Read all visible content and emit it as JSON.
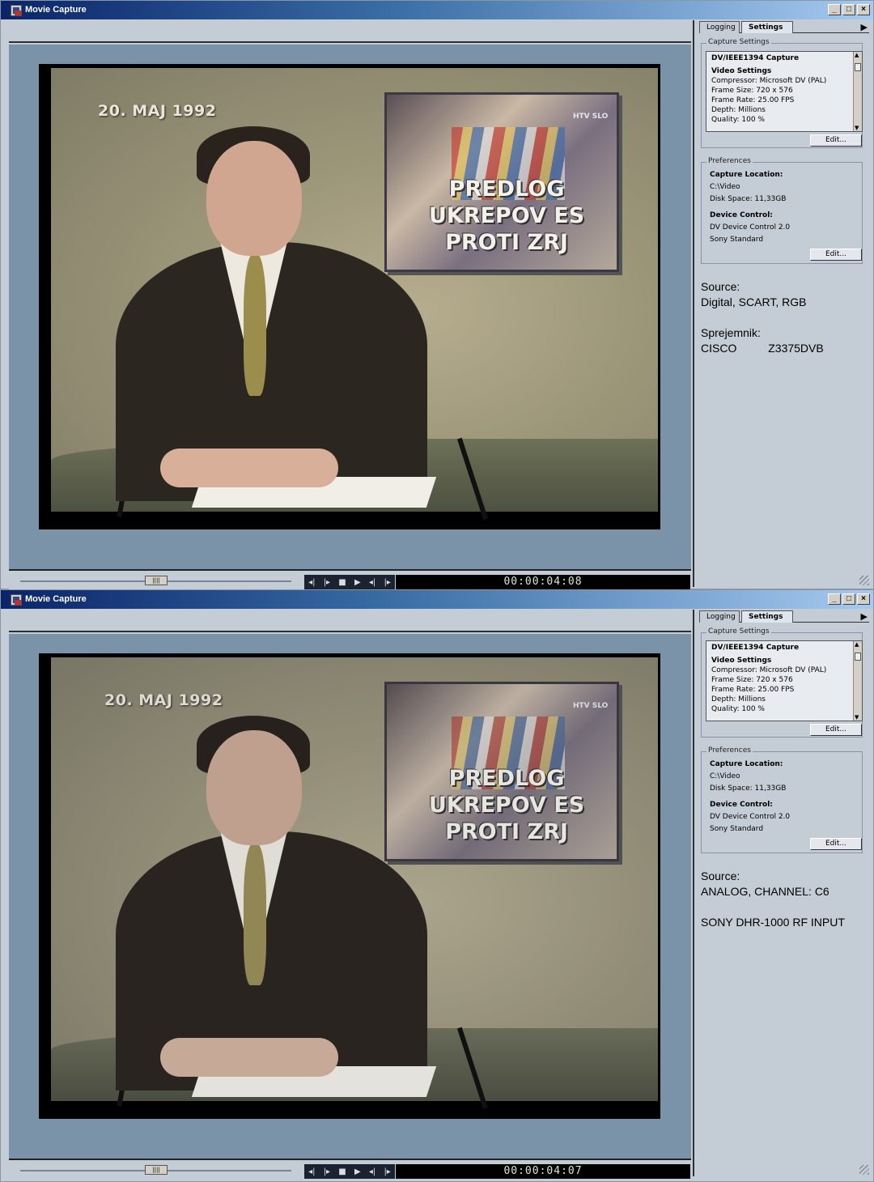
{
  "windows": [
    {
      "title": "Movie Capture",
      "video": {
        "date_overlay": "20. MAJ 1992",
        "headline_lines": [
          "PREDLOG",
          "UKREPOV ES",
          "PROTI ZRJ"
        ],
        "logo_text": "HTV SLO"
      },
      "timecode": "00:00:04:08",
      "tabs": {
        "logging": "Logging",
        "settings": "Settings"
      },
      "capture_settings": {
        "legend": "Capture Settings",
        "heading": "DV/IEEE1394 Capture",
        "subheading": "Video Settings",
        "lines": [
          "Compressor: Microsoft DV (PAL)",
          "Frame Size: 720 x 576",
          "Frame Rate: 25.00 FPS",
          "Depth: Millions",
          "Quality: 100 %"
        ],
        "edit_label": "Edit..."
      },
      "preferences": {
        "legend": "Preferences",
        "capture_location_label": "Capture Location:",
        "capture_location_lines": [
          "C:\\Video",
          "Disk Space: 11,33GB"
        ],
        "device_control_label": "Device Control:",
        "device_control_lines": [
          "DV Device Control 2.0",
          "Sony Standard"
        ],
        "edit_label": "Edit..."
      },
      "notes": [
        "Source:",
        "Digital, SCART, RGB",
        "",
        "Sprejemnik:",
        "CISCO          Z3375DVB"
      ]
    },
    {
      "title": "Movie Capture",
      "video": {
        "date_overlay": "20. MAJ 1992",
        "headline_lines": [
          "PREDLOG",
          "UKREPOV ES",
          "PROTI ZRJ"
        ],
        "logo_text": "HTV SLO"
      },
      "timecode": "00:00:04:07",
      "tabs": {
        "logging": "Logging",
        "settings": "Settings"
      },
      "capture_settings": {
        "legend": "Capture Settings",
        "heading": "DV/IEEE1394 Capture",
        "subheading": "Video Settings",
        "lines": [
          "Compressor: Microsoft DV (PAL)",
          "Frame Size: 720 x 576",
          "Frame Rate: 25.00 FPS",
          "Depth: Millions",
          "Quality: 100 %"
        ],
        "edit_label": "Edit..."
      },
      "preferences": {
        "legend": "Preferences",
        "capture_location_label": "Capture Location:",
        "capture_location_lines": [
          "C:\\Video",
          "Disk Space: 11,33GB"
        ],
        "device_control_label": "Device Control:",
        "device_control_lines": [
          "DV Device Control 2.0",
          "Sony Standard"
        ],
        "edit_label": "Edit..."
      },
      "notes": [
        "Source:",
        "ANALOG, CHANNEL: C6",
        "",
        "SONY DHR-1000 RF INPUT"
      ]
    }
  ],
  "icons": {
    "app": "movie-capture-icon",
    "minimize": "minimize-icon",
    "maximize": "maximize-icon",
    "close": "close-icon",
    "panel_menu": "panel-menu-arrow-icon",
    "clip": "clip-icon",
    "audio": "audio-waveform-icon",
    "transport": [
      "step-back-icon",
      "step-forward-icon",
      "stop-icon",
      "play-icon",
      "jog-back-icon",
      "jog-forward-icon"
    ],
    "controls": [
      "rewind-icon",
      "fast-forward-icon",
      "pause-icon",
      "record-icon",
      "mark-in-icon",
      "mark-out-icon"
    ]
  },
  "colors": {
    "title_bar_start": "#0a246a",
    "title_bar_end": "#a6caf0",
    "panel_bg": "#c4ccd6",
    "video_bg": "#7b93a8",
    "record": "#e01010"
  }
}
